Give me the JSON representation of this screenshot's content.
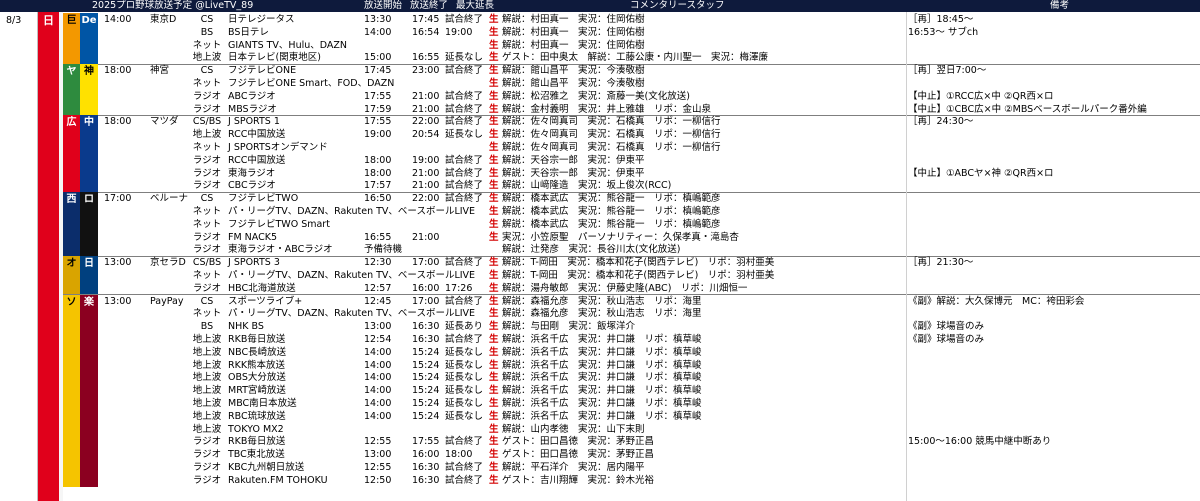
{
  "header": {
    "title": "2025プロ野球放送予定 @LiveTV_89",
    "col_start": "放送開始",
    "col_end": "放送終了",
    "col_ext": "最大延長",
    "col_staff": "コメンタリースタッフ",
    "col_note": "備考"
  },
  "date": "8/3",
  "day": "日",
  "colors": {
    "header_bg": "#0e1a3c",
    "sunday": "#e0001b",
    "live_mark": "#d40000"
  },
  "games": [
    {
      "team_a": "巨",
      "team_a_bg": "#f39800",
      "team_a_fg": "#000000",
      "team_b": "De",
      "team_b_bg": "#0055a5",
      "team_b_fg": "#ffffff",
      "time": "14:00",
      "stadium": "東京D",
      "rows": [
        {
          "type": "CS",
          "name": "日テレジータス",
          "start": "13:30",
          "end": "17:45",
          "ext": "試合終了",
          "live": "生",
          "comm": "解説：村田真一　実況：住岡佑樹",
          "note": "［再］18:45～"
        },
        {
          "type": "BS",
          "name": "BS日テレ",
          "start": "14:00",
          "end": "16:54",
          "ext": "19:00",
          "live": "生",
          "comm": "解説：村田真一　実況：住岡佑樹",
          "note": "16:53～ サブch"
        },
        {
          "type": "ネット",
          "name": "GIANTS TV、Hulu、DAZN",
          "start": "",
          "end": "",
          "ext": "",
          "live": "生",
          "comm": "解説：村田真一　実況：住岡佑樹",
          "note": ""
        },
        {
          "type": "地上波",
          "name": "日本テレビ(関東地区)",
          "start": "15:00",
          "end": "16:55",
          "ext": "延長なし",
          "live": "生",
          "comm": "ゲスト：田中奥太　解説：工藤公康・内川聖一　実況：梅澤廉",
          "note": ""
        }
      ]
    },
    {
      "team_a": "ヤ",
      "team_a_bg": "#2e8b3e",
      "team_a_fg": "#ffffff",
      "team_b": "神",
      "team_b_bg": "#ffe100",
      "team_b_fg": "#000000",
      "time": "18:00",
      "stadium": "神宮",
      "rows": [
        {
          "type": "CS",
          "name": "フジテレビONE",
          "start": "17:45",
          "end": "23:00",
          "ext": "試合終了",
          "live": "生",
          "comm": "解説：館山昌平　実況：今湊敬樹",
          "note": "［再］翌日7:00～"
        },
        {
          "type": "ネット",
          "name": "フジテレビONE Smart、FOD、DAZN",
          "start": "",
          "end": "",
          "ext": "",
          "live": "生",
          "comm": "解説：館山昌平　実況：今湊敬樹",
          "note": ""
        },
        {
          "type": "ラジオ",
          "name": "ABCラジオ",
          "start": "17:55",
          "end": "21:00",
          "ext": "試合終了",
          "live": "生",
          "comm": "解説：松沼雅之　実況：斎藤一美(文化放送)",
          "note": "【中止】①RCC広×中 ②QR西×ロ"
        },
        {
          "type": "ラジオ",
          "name": "MBSラジオ",
          "start": "17:59",
          "end": "21:00",
          "ext": "試合終了",
          "live": "生",
          "comm": "解説：金村義明　実況：井上雅雄　リポ：金山泉",
          "note": "【中止】①CBC広×中 ②MBSベースボールパーク番外編"
        }
      ]
    },
    {
      "team_a": "広",
      "team_a_bg": "#e0001b",
      "team_a_fg": "#ffffff",
      "team_b": "中",
      "team_b_bg": "#0a3a8c",
      "team_b_fg": "#ffffff",
      "time": "18:00",
      "stadium": "マツダ",
      "rows": [
        {
          "type": "CS/BS",
          "name": "J SPORTS 1",
          "start": "17:55",
          "end": "22:00",
          "ext": "試合終了",
          "live": "生",
          "comm": "解説：佐々岡真司　実況：石橋真　リポ：一柳信行",
          "note": "［再］24:30～"
        },
        {
          "type": "地上波",
          "name": "RCC中国放送",
          "start": "19:00",
          "end": "20:54",
          "ext": "延長なし",
          "live": "生",
          "comm": "解説：佐々岡真司　実況：石橋真　リポ：一柳信行",
          "note": ""
        },
        {
          "type": "ネット",
          "name": "J SPORTSオンデマンド",
          "start": "",
          "end": "",
          "ext": "",
          "live": "生",
          "comm": "解説：佐々岡真司　実況：石橋真　リポ：一柳信行",
          "note": ""
        },
        {
          "type": "ラジオ",
          "name": "RCC中国放送",
          "start": "18:00",
          "end": "19:00",
          "ext": "試合終了",
          "live": "生",
          "comm": "解説：天谷宗一郎　実況：伊東平",
          "note": ""
        },
        {
          "type": "ラジオ",
          "name": "東海ラジオ",
          "start": "18:00",
          "end": "21:00",
          "ext": "試合終了",
          "live": "生",
          "comm": "解説：天谷宗一郎　実況：伊東平",
          "note": "【中止】①ABCヤ×神 ②QR西×ロ"
        },
        {
          "type": "ラジオ",
          "name": "CBCラジオ",
          "start": "17:57",
          "end": "21:00",
          "ext": "試合終了",
          "live": "生",
          "comm": "解説：山﨑隆造　実況：坂上俊次(RCC)",
          "note": ""
        }
      ]
    },
    {
      "team_a": "西",
      "team_a_bg": "#0b2d6b",
      "team_a_fg": "#ffffff",
      "team_b": "ロ",
      "team_b_bg": "#111111",
      "team_b_fg": "#ffffff",
      "time": "17:00",
      "stadium": "ベルーナ",
      "rows": [
        {
          "type": "CS",
          "name": "フジテレビTWO",
          "start": "16:50",
          "end": "22:00",
          "ext": "試合終了",
          "live": "生",
          "comm": "解説：橋本武広　実況：熊谷龍一　リポ：槙嶋範彦",
          "note": ""
        },
        {
          "type": "ネット",
          "name": "パ・リーグTV、DAZN、Rakuten TV、ベースボールLIVE",
          "start": "",
          "end": "",
          "ext": "",
          "live": "生",
          "comm": "解説：橋本武広　実況：熊谷龍一　リポ：槙嶋範彦",
          "note": ""
        },
        {
          "type": "ネット",
          "name": "フジテレビTWO Smart",
          "start": "",
          "end": "",
          "ext": "",
          "live": "生",
          "comm": "解説：橋本武広　実況：熊谷龍一　リポ：槙嶋範彦",
          "note": ""
        },
        {
          "type": "ラジオ",
          "name": "FM NACK5",
          "start": "16:55",
          "end": "21:00",
          "ext": "",
          "live": "生",
          "comm": "実況：小笠原聖　パーソナリティー：久保孝真・滝島杏",
          "note": ""
        },
        {
          "type": "ラジオ",
          "name": "東海ラジオ・ABCラジオ",
          "start": "予備待機",
          "end": "",
          "ext": "",
          "live": "",
          "comm": "解説：辻発彦　実況：長谷川太(文化放送)",
          "note": ""
        }
      ]
    },
    {
      "team_a": "オ",
      "team_a_bg": "#d9a400",
      "team_a_fg": "#000000",
      "team_b": "日",
      "team_b_bg": "#00407f",
      "team_b_fg": "#ffffff",
      "time": "13:00",
      "stadium": "京セラD",
      "rows": [
        {
          "type": "CS/BS",
          "name": "J SPORTS 3",
          "start": "12:30",
          "end": "17:00",
          "ext": "試合終了",
          "live": "生",
          "comm": "解説：T-岡田　実況：橋本和花子(関西テレビ)　リポ：羽村亜美",
          "note": "［再］21:30～"
        },
        {
          "type": "ネット",
          "name": "パ・リーグTV、DAZN、Rakuten TV、ベースボールLIVE",
          "start": "",
          "end": "",
          "ext": "",
          "live": "生",
          "comm": "解説：T-岡田　実況：橋本和花子(関西テレビ)　リポ：羽村亜美",
          "note": ""
        },
        {
          "type": "ラジオ",
          "name": "HBC北海道放送",
          "start": "12:57",
          "end": "16:00",
          "ext": "17:26",
          "live": "生",
          "comm": "解説：湯舟敏郎　実況：伊藤史隆(ABC)　リポ：川畑恒一",
          "note": ""
        }
      ]
    },
    {
      "team_a": "ソ",
      "team_a_bg": "#f5c400",
      "team_a_fg": "#000000",
      "team_b": "楽",
      "team_b_bg": "#8b0020",
      "team_b_fg": "#ffffff",
      "time": "13:00",
      "stadium": "PayPay",
      "rows": [
        {
          "type": "CS",
          "name": "スポーツライブ+",
          "start": "12:45",
          "end": "17:00",
          "ext": "試合終了",
          "live": "生",
          "comm": "解説：森福允彦　実況：秋山浩志　リポ：海里",
          "note": "《副》解説：大久保博元　MC：袴田彩会"
        },
        {
          "type": "ネット",
          "name": "パ・リーグTV、DAZN、Rakuten TV、ベースボールLIVE",
          "start": "",
          "end": "",
          "ext": "",
          "live": "生",
          "comm": "解説：森福允彦　実況：秋山浩志　リポ：海里",
          "note": ""
        },
        {
          "type": "BS",
          "name": "NHK BS",
          "start": "13:00",
          "end": "16:30",
          "ext": "延長あり",
          "live": "生",
          "comm": "解説：与田剛　実況：飯塚洋介",
          "note": "《副》球場音のみ"
        },
        {
          "type": "地上波",
          "name": "RKB毎日放送",
          "start": "12:54",
          "end": "16:30",
          "ext": "試合終了",
          "live": "生",
          "comm": "解説：浜名千広　実況：井口謙　リポ：槙草峻",
          "note": "《副》球場音のみ"
        },
        {
          "type": "地上波",
          "name": "NBC長崎放送",
          "start": "14:00",
          "end": "15:24",
          "ext": "延長なし",
          "live": "生",
          "comm": "解説：浜名千広　実況：井口謙　リポ：槙草峻",
          "note": ""
        },
        {
          "type": "地上波",
          "name": "RKK熊本放送",
          "start": "14:00",
          "end": "15:24",
          "ext": "延長なし",
          "live": "生",
          "comm": "解説：浜名千広　実況：井口謙　リポ：槙草峻",
          "note": ""
        },
        {
          "type": "地上波",
          "name": "OBS大分放送",
          "start": "14:00",
          "end": "15:24",
          "ext": "延長なし",
          "live": "生",
          "comm": "解説：浜名千広　実況：井口謙　リポ：槙草峻",
          "note": ""
        },
        {
          "type": "地上波",
          "name": "MRT宮崎放送",
          "start": "14:00",
          "end": "15:24",
          "ext": "延長なし",
          "live": "生",
          "comm": "解説：浜名千広　実況：井口謙　リポ：槙草峻",
          "note": ""
        },
        {
          "type": "地上波",
          "name": "MBC南日本放送",
          "start": "14:00",
          "end": "15:24",
          "ext": "延長なし",
          "live": "生",
          "comm": "解説：浜名千広　実況：井口謙　リポ：槙草峻",
          "note": ""
        },
        {
          "type": "地上波",
          "name": "RBC琉球放送",
          "start": "14:00",
          "end": "15:24",
          "ext": "延長なし",
          "live": "生",
          "comm": "解説：浜名千広　実況：井口謙　リポ：槙草峻",
          "note": ""
        },
        {
          "type": "地上波",
          "name": "TOKYO MX2",
          "start": "",
          "end": "",
          "ext": "",
          "live": "生",
          "comm": "解説：山内孝徳　実況：山下末則",
          "note": ""
        },
        {
          "type": "ラジオ",
          "name": "RKB毎日放送",
          "start": "12:55",
          "end": "17:55",
          "ext": "試合終了",
          "live": "生",
          "comm": "ゲスト：田口昌徳　実況：茅野正昌",
          "note": "15:00～16:00 競馬中継中断あり"
        },
        {
          "type": "ラジオ",
          "name": "TBC東北放送",
          "start": "13:00",
          "end": "16:00",
          "ext": "18:00",
          "live": "生",
          "comm": "ゲスト：田口昌徳　実況：茅野正昌",
          "note": ""
        },
        {
          "type": "ラジオ",
          "name": "KBC九州朝日放送",
          "start": "12:55",
          "end": "16:30",
          "ext": "試合終了",
          "live": "生",
          "comm": "解説：平石洋介　実況：居内陽平",
          "note": ""
        },
        {
          "type": "ラジオ",
          "name": "Rakuten.FM TOHOKU",
          "start": "12:50",
          "end": "16:30",
          "ext": "試合終了",
          "live": "生",
          "comm": "ゲスト：吉川翔輝　実況：鈴木光裕",
          "note": ""
        }
      ]
    }
  ]
}
